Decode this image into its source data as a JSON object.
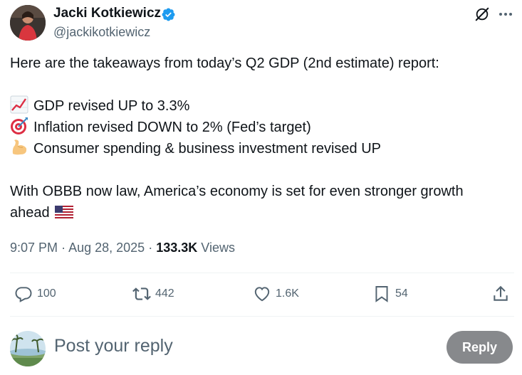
{
  "author": {
    "display_name": "Jacki Kotkiewicz",
    "handle": "@jackikotkiewicz",
    "verified": true
  },
  "header_icons": [
    "grok-icon",
    "more-icon"
  ],
  "tweet": {
    "intro": "Here are the takeaways from today’s Q2 GDP (2nd estimate) report:",
    "bullets": [
      {
        "icon": "chart-increasing-icon",
        "text": "GDP revised UP to 3.3%"
      },
      {
        "icon": "direct-hit-icon",
        "text": "Inflation revised DOWN to 2% (Fed’s target)"
      },
      {
        "icon": "flexed-biceps-icon",
        "text": "Consumer spending & business investment revised UP"
      }
    ],
    "closing_line1": "With OBBB now law, America’s economy is set for even stronger growth",
    "closing_line2": "ahead",
    "closing_icon": "us-flag-icon"
  },
  "meta": {
    "time": "9:07 PM",
    "separator": "·",
    "date": "Aug 28, 2025",
    "views_count": "133.3K",
    "views_label": "Views"
  },
  "actions": {
    "replies": "100",
    "reposts": "442",
    "likes": "1.6K",
    "bookmarks": "54"
  },
  "composer": {
    "placeholder": "Post your reply",
    "button_label": "Reply"
  },
  "colors": {
    "text": "#0f1419",
    "secondary": "#536471",
    "verified": "#1d9bf0",
    "reply_button": "#87898c"
  }
}
